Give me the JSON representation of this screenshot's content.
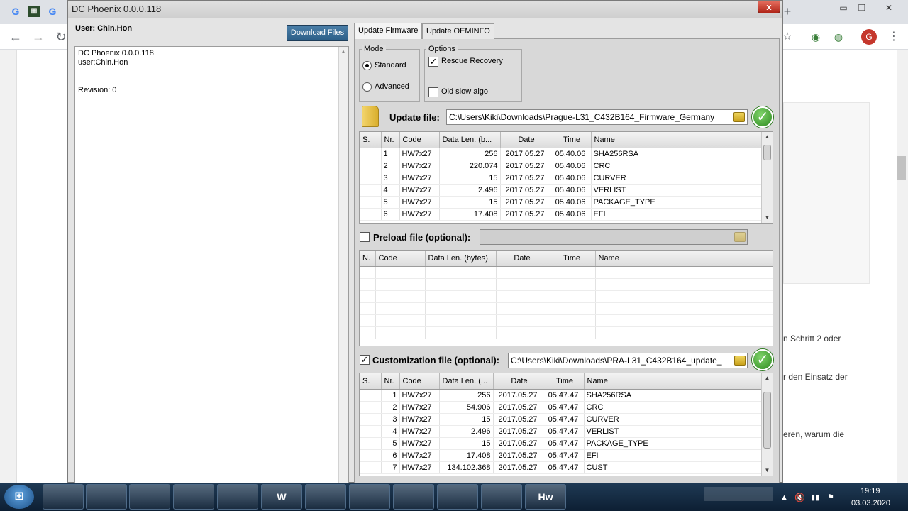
{
  "browser": {
    "tab_icons": [
      "G",
      "G"
    ],
    "avatar_letter": "G",
    "page_text": [
      "n Schritt 2 oder",
      "r den Einsatz der",
      "eren, warum die"
    ]
  },
  "app": {
    "title": "DC Phoenix 0.0.0.118",
    "close_label": "x",
    "user_label": "User: Chin.Hon",
    "download_button": "Download Files",
    "log": [
      "DC Phoenix 0.0.0.118",
      "user:Chin.Hon",
      "Revision: 0"
    ],
    "tabs": [
      {
        "label": "Update Firmware",
        "active": true
      },
      {
        "label": "Update OEMINFO",
        "active": false
      }
    ],
    "mode": {
      "title": "Mode",
      "options": [
        {
          "label": "Standard",
          "selected": true
        },
        {
          "label": "Advanced",
          "selected": false
        }
      ]
    },
    "options": {
      "title": "Options",
      "items": [
        {
          "label": "Rescue Recovery",
          "checked": true
        },
        {
          "label": "Old slow algo",
          "checked": false
        }
      ]
    },
    "update_file": {
      "label": "Update file:",
      "path": "C:\\Users\\Kiki\\Downloads\\Prague-L31_C432B164_Firmware_Germany",
      "columns": [
        "S.",
        "Nr.",
        "Code",
        "Data Len. (b...",
        "Date",
        "Time",
        "Name"
      ],
      "rows": [
        [
          "",
          "1",
          "HW7x27",
          "256",
          "2017.05.27",
          "05.40.06",
          "SHA256RSA"
        ],
        [
          "",
          "2",
          "HW7x27",
          "220.074",
          "2017.05.27",
          "05.40.06",
          "CRC"
        ],
        [
          "",
          "3",
          "HW7x27",
          "15",
          "2017.05.27",
          "05.40.06",
          "CURVER"
        ],
        [
          "",
          "4",
          "HW7x27",
          "2.496",
          "2017.05.27",
          "05.40.06",
          "VERLIST"
        ],
        [
          "",
          "5",
          "HW7x27",
          "15",
          "2017.05.27",
          "05.40.06",
          "PACKAGE_TYPE"
        ],
        [
          "",
          "6",
          "HW7x27",
          "17.408",
          "2017.05.27",
          "05.40.06",
          "EFI"
        ]
      ]
    },
    "preload_file": {
      "label": "Preload file (optional):",
      "checked": false,
      "path": "",
      "columns": [
        "N.",
        "Code",
        "Data Len. (bytes)",
        "Date",
        "Time",
        "Name"
      ]
    },
    "custom_file": {
      "label": "Customization file (optional):",
      "checked": true,
      "path": "C:\\Users\\Kiki\\Downloads\\PRA-L31_C432B164_update_",
      "columns": [
        "S.",
        "Nr.",
        "Code",
        "Data Len. (...",
        "Date",
        "Time",
        "Name"
      ],
      "rows": [
        [
          "",
          "1",
          "HW7x27",
          "256",
          "2017.05.27",
          "05.47.47",
          "SHA256RSA"
        ],
        [
          "",
          "2",
          "HW7x27",
          "54.906",
          "2017.05.27",
          "05.47.47",
          "CRC"
        ],
        [
          "",
          "3",
          "HW7x27",
          "15",
          "2017.05.27",
          "05.47.47",
          "CURVER"
        ],
        [
          "",
          "4",
          "HW7x27",
          "2.496",
          "2017.05.27",
          "05.47.47",
          "VERLIST"
        ],
        [
          "",
          "5",
          "HW7x27",
          "15",
          "2017.05.27",
          "05.47.47",
          "PACKAGE_TYPE"
        ],
        [
          "",
          "6",
          "HW7x27",
          "17.408",
          "2017.05.27",
          "05.47.47",
          "EFI"
        ],
        [
          "",
          "7",
          "HW7x27",
          "134.102.368",
          "2017.05.27",
          "05.47.47",
          "CUST"
        ]
      ]
    }
  },
  "taskbar": {
    "items": [
      "",
      "",
      "",
      "",
      "",
      "W",
      "",
      "",
      "",
      "",
      "",
      "Hw"
    ],
    "time": "19:19",
    "date": "03.03.2020"
  },
  "icons": {
    "ok": "check-icon",
    "browse": "folder-open-icon",
    "start": "windows-logo-icon"
  }
}
